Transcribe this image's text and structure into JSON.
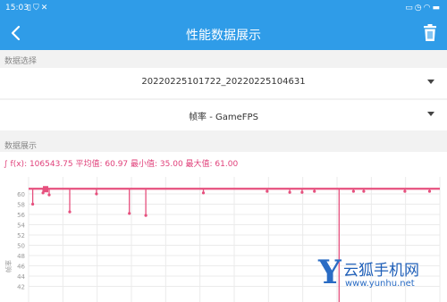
{
  "status_bar": {
    "time": "15:03",
    "left_icons": [
      "sim-icon",
      "shield-icon",
      "tools-icon"
    ],
    "right_icons": [
      "cast-icon",
      "alarm-icon",
      "wifi-icon",
      "battery-icon"
    ]
  },
  "header": {
    "title": "性能数据展示",
    "back_icon": "back-arrow-icon",
    "delete_icon": "trash-icon"
  },
  "data_select": {
    "section_label": "数据选择",
    "session_value": "20220225101722_20220225104631",
    "metric_value": "帧率 - GameFPS"
  },
  "data_display": {
    "section_label": "数据展示",
    "stats_text": "∫ f(x): 106543.75 平均值: 60.97 最小值: 35.00 最大值: 61.00"
  },
  "chart_data": {
    "type": "line",
    "ylabel": "帧率",
    "y_ticks": [
      60,
      58,
      56,
      54,
      52,
      50,
      48,
      46,
      44,
      42
    ],
    "baseline": 61,
    "dips": [
      {
        "x": 0.01,
        "y": 58
      },
      {
        "x": 0.035,
        "y": 60.2
      },
      {
        "x": 0.05,
        "y": 59.8
      },
      {
        "x": 0.1,
        "y": 56.5
      },
      {
        "x": 0.165,
        "y": 60
      },
      {
        "x": 0.245,
        "y": 56.2
      },
      {
        "x": 0.285,
        "y": 55.8
      },
      {
        "x": 0.425,
        "y": 60.2
      },
      {
        "x": 0.58,
        "y": 60.5
      },
      {
        "x": 0.635,
        "y": 60.3
      },
      {
        "x": 0.665,
        "y": 60.3
      },
      {
        "x": 0.695,
        "y": 60.5
      },
      {
        "x": 0.755,
        "y": 35
      },
      {
        "x": 0.79,
        "y": 60.5
      },
      {
        "x": 0.815,
        "y": 60.5
      },
      {
        "x": 0.915,
        "y": 60.5
      },
      {
        "x": 0.975,
        "y": 60.5
      }
    ],
    "colors": {
      "line": "#e6507e",
      "grid": "#ebebeb",
      "tick": "#999999"
    }
  },
  "watermark": {
    "letter": "Y",
    "brand": "云狐手机网",
    "url": "www.yunhu.net"
  }
}
